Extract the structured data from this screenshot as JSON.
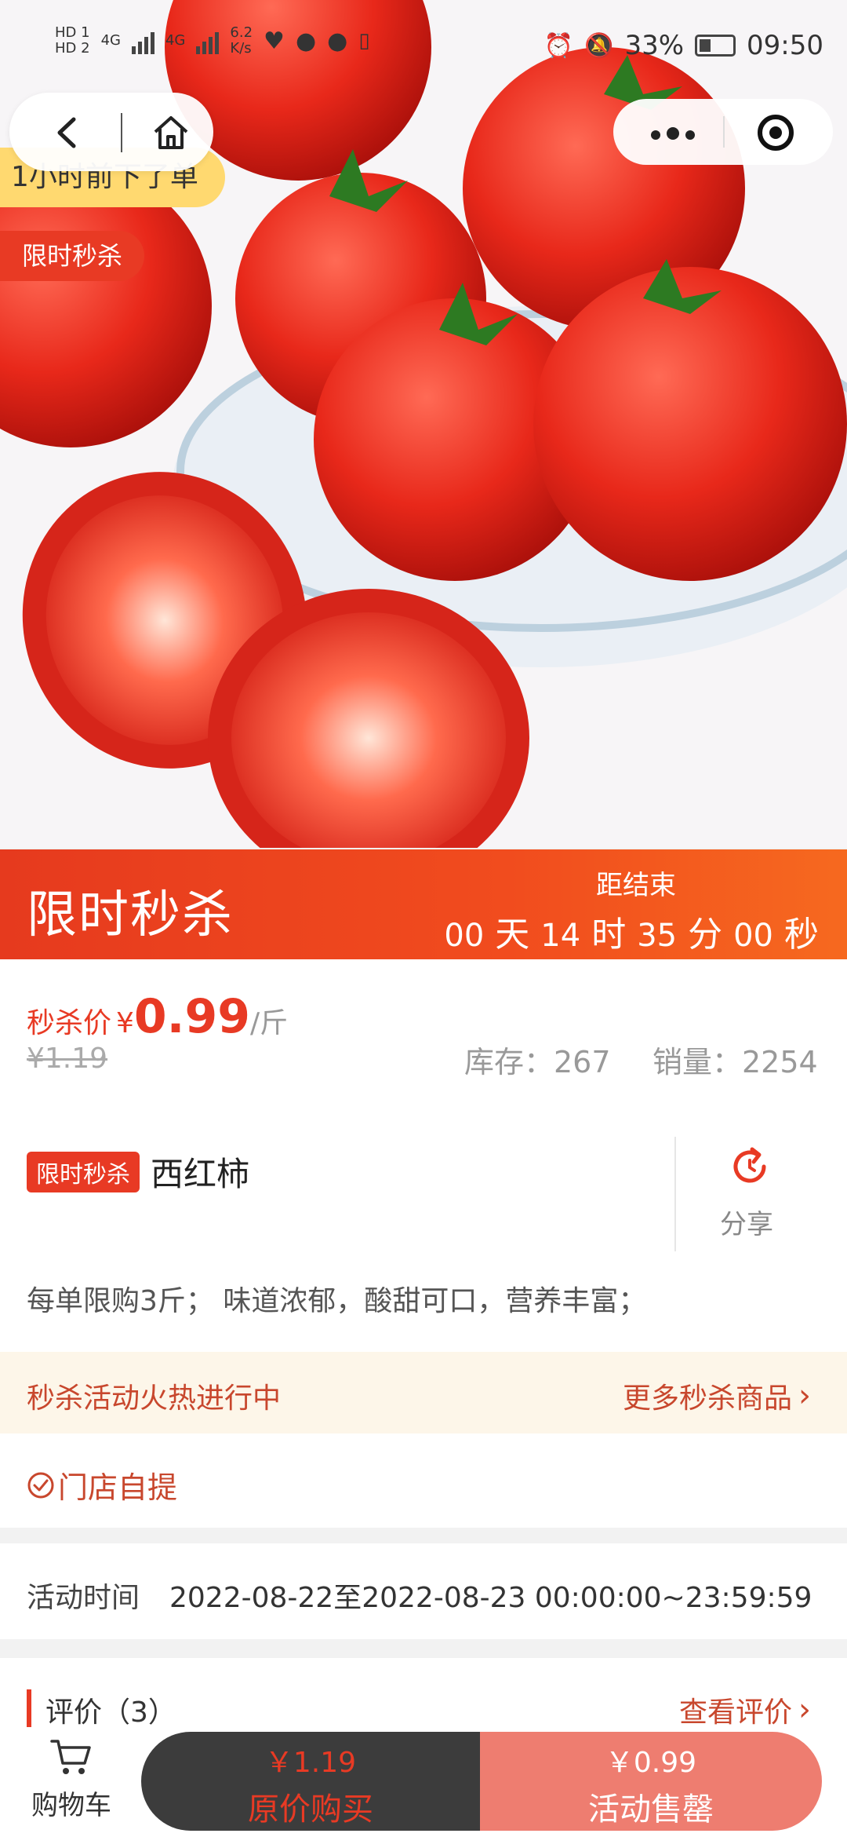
{
  "status_bar": {
    "hd1": "HD 1",
    "hd2": "HD 2",
    "net1": "4G",
    "net2": "4G",
    "speed_value": "6.2",
    "speed_unit": "K/s",
    "battery": "33%",
    "time": "09:50"
  },
  "hero": {
    "order_notice": "1小时前下了单",
    "badge": "限时秒杀"
  },
  "flash_sale": {
    "title": "限时秒杀",
    "ends_label": "距结束",
    "days": "00",
    "days_unit": "天",
    "hours": "14",
    "hours_unit": "时",
    "minutes": "35",
    "minutes_unit": "分",
    "seconds": "00",
    "seconds_unit": "秒"
  },
  "price": {
    "label": "秒杀价",
    "currency": "¥",
    "value": "0.99",
    "unit": "/斤",
    "original": "¥1.19",
    "stock": "库存：267",
    "sales": "销量：2254"
  },
  "product": {
    "tag": "限时秒杀",
    "name": "西红柿",
    "share": "分享",
    "description": "每单限购3斤； 味道浓郁，酸甜可口，营养丰富；"
  },
  "promo": {
    "left": "秒杀活动火热进行中",
    "right": "更多秒杀商品"
  },
  "pickup": {
    "label": "门店自提"
  },
  "activity": {
    "label": "活动时间",
    "value": "2022-08-22至2022-08-23 00:00:00~23:59:59"
  },
  "reviews": {
    "title": "评价（3）",
    "more": "查看评价"
  },
  "bottom_bar": {
    "cart_label": "购物车",
    "orig_price": "￥1.19",
    "orig_label": "原价购买",
    "sale_price": "￥0.99",
    "sale_label": "活动售罄"
  }
}
